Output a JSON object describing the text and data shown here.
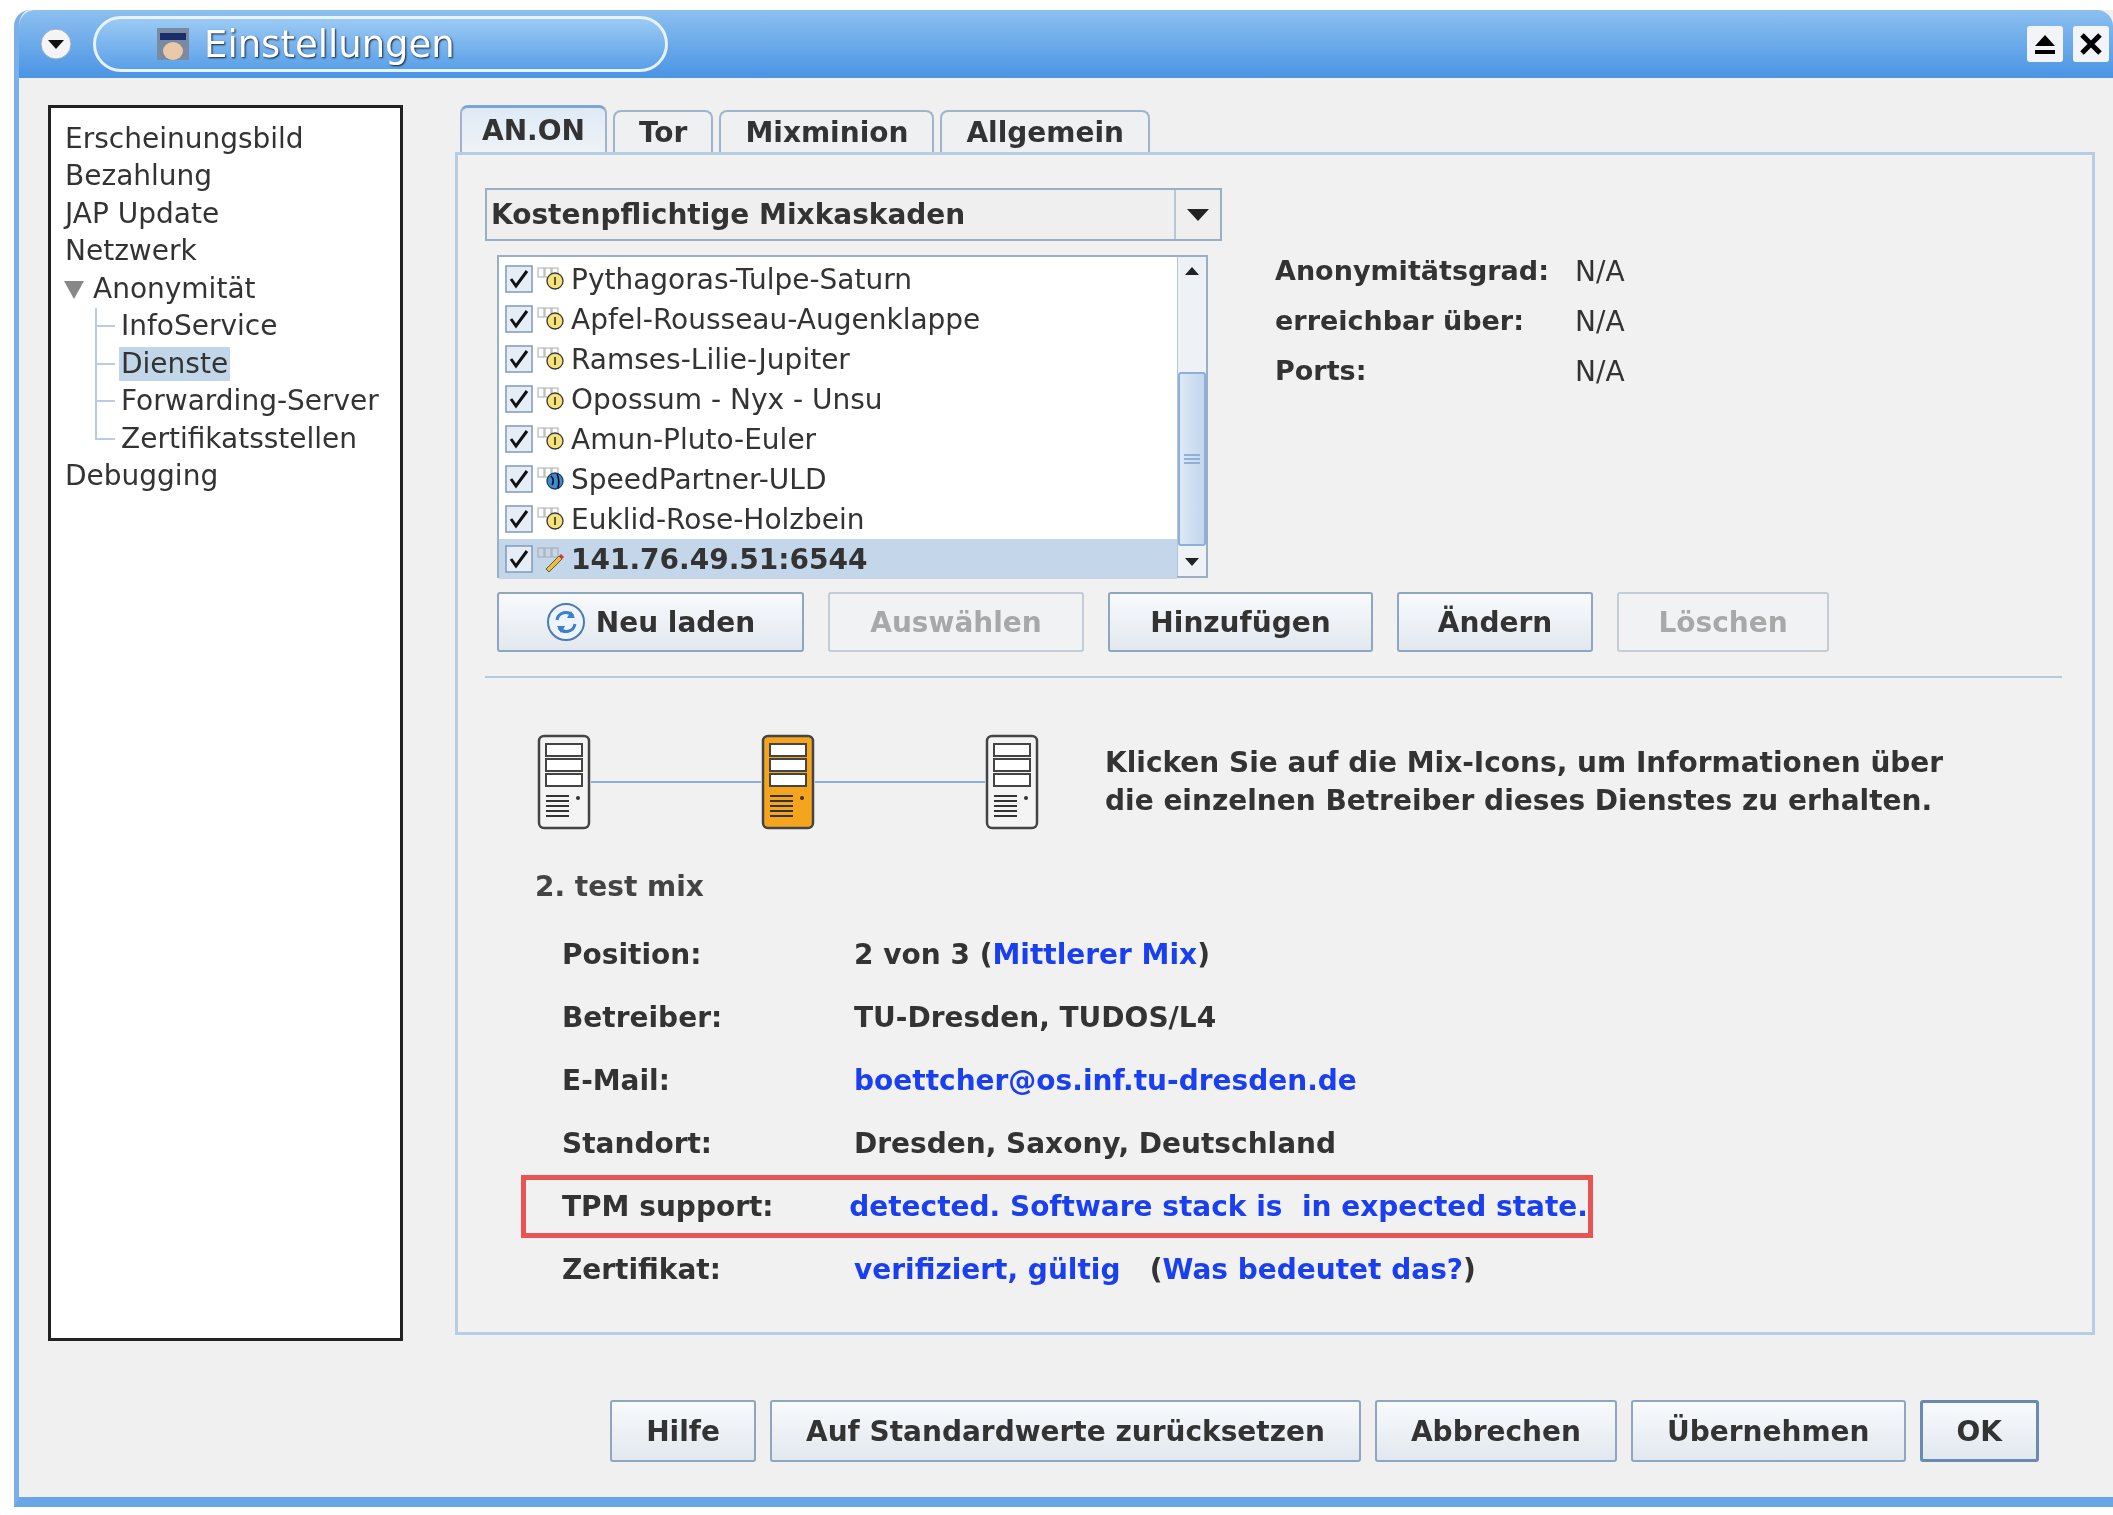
{
  "window": {
    "title": "Einstellungen"
  },
  "nav_tree": [
    {
      "label": "Erscheinungsbild",
      "selected": false
    },
    {
      "label": "Bezahlung",
      "selected": false
    },
    {
      "label": "JAP Update",
      "selected": false
    },
    {
      "label": "Netzwerk",
      "selected": false
    },
    {
      "label": "Anonymität",
      "selected": false,
      "expanded": true,
      "children": [
        {
          "label": "InfoService",
          "selected": false
        },
        {
          "label": "Dienste",
          "selected": true
        },
        {
          "label": "Forwarding-Server",
          "selected": false
        },
        {
          "label": "Zertifikatsstellen",
          "selected": false
        }
      ]
    },
    {
      "label": "Debugging",
      "selected": false
    }
  ],
  "tabs": [
    {
      "label": "AN.ON",
      "selected": true
    },
    {
      "label": "Tor",
      "selected": false
    },
    {
      "label": "Mixminion",
      "selected": false
    },
    {
      "label": "Allgemein",
      "selected": false
    }
  ],
  "cascade_filter": {
    "value": "Kostenpflichtige Mixkaskaden"
  },
  "cascades": [
    {
      "name": "Pythagoras-Tulpe-Saturn",
      "checked": true,
      "selected": false,
      "kind": "paid"
    },
    {
      "name": "Apfel-Rousseau-Augenklappe",
      "checked": true,
      "selected": false,
      "kind": "paid"
    },
    {
      "name": "Ramses-Lilie-Jupiter",
      "checked": true,
      "selected": false,
      "kind": "paid"
    },
    {
      "name": "Opossum - Nyx - Unsu",
      "checked": true,
      "selected": false,
      "kind": "paid"
    },
    {
      "name": "Amun-Pluto-Euler",
      "checked": true,
      "selected": false,
      "kind": "paid"
    },
    {
      "name": "SpeedPartner-ULD",
      "checked": true,
      "selected": false,
      "kind": "free"
    },
    {
      "name": "Euklid-Rose-Holzbein",
      "checked": true,
      "selected": false,
      "kind": "paid"
    },
    {
      "name": "141.76.49.51:6544",
      "checked": true,
      "selected": true,
      "kind": "custom"
    }
  ],
  "cascade_info": [
    {
      "label": "Anonymitätsgrad:",
      "value": "N/A"
    },
    {
      "label": "erreichbar über:",
      "value": "N/A"
    },
    {
      "label": "Ports:",
      "value": "N/A"
    }
  ],
  "cascade_buttons": [
    {
      "label": "Neu laden",
      "disabled": false,
      "kind": "reload"
    },
    {
      "label": "Auswählen",
      "disabled": true,
      "kind": "plain"
    },
    {
      "label": "Hinzufügen",
      "disabled": false,
      "kind": "plain"
    },
    {
      "label": "Ändern",
      "disabled": false,
      "kind": "plain"
    },
    {
      "label": "Löschen",
      "disabled": true,
      "kind": "plain"
    }
  ],
  "mixes": [
    {
      "selected": false
    },
    {
      "selected": true
    },
    {
      "selected": false
    }
  ],
  "mix_hint": "Klicken Sie auf die Mix-Icons, um Informationen über\ndie einzelnen Betreiber dieses Dienstes zu erhalten.",
  "mix_title": "2. test mix",
  "mix_details": [
    {
      "label": "Position:",
      "highlighted": false,
      "parts": [
        {
          "text": "2 von 3 (",
          "link": false
        },
        {
          "text": "Mittlerer Mix",
          "link": true
        },
        {
          "text": ")",
          "link": false
        }
      ]
    },
    {
      "label": "Betreiber:",
      "highlighted": false,
      "parts": [
        {
          "text": "TU-Dresden, TUDOS/L4",
          "link": false
        }
      ]
    },
    {
      "label": "E-Mail:",
      "highlighted": false,
      "parts": [
        {
          "text": "boettcher@os.inf.tu-dresden.de",
          "link": true
        }
      ]
    },
    {
      "label": "Standort:",
      "highlighted": false,
      "parts": [
        {
          "text": "Dresden, Saxony, Deutschland",
          "link": false
        }
      ]
    },
    {
      "label": "TPM support:",
      "highlighted": true,
      "parts": [
        {
          "text": "detected. Software stack is  in expected state.",
          "link": true
        }
      ]
    },
    {
      "label": "Zertifikat:",
      "highlighted": false,
      "parts": [
        {
          "text": "verifiziert, gültig",
          "link": true
        },
        {
          "text": "   (",
          "link": false
        },
        {
          "text": "Was bedeutet das?",
          "link": true
        },
        {
          "text": ")",
          "link": false
        }
      ]
    }
  ],
  "dialog_buttons": [
    {
      "label": "Hilfe",
      "default": false
    },
    {
      "label": "Auf Standardwerte zurücksetzen",
      "default": false
    },
    {
      "label": "Abbrechen",
      "default": false
    },
    {
      "label": "Übernehmen",
      "default": false
    },
    {
      "label": "OK",
      "default": true
    }
  ]
}
